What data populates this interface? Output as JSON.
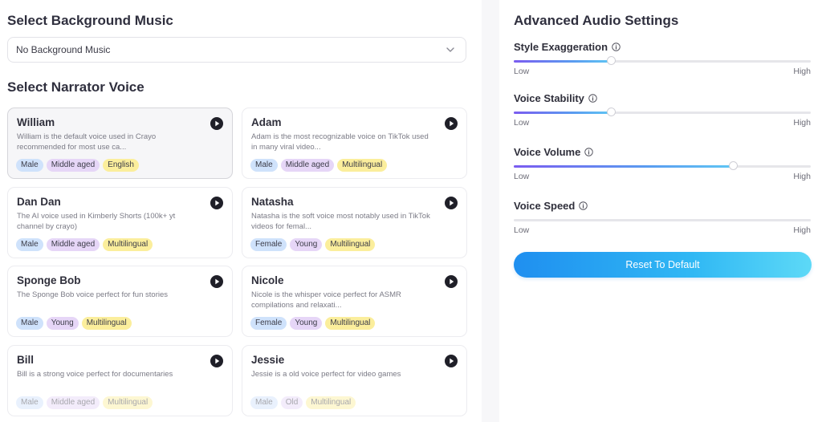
{
  "music": {
    "title": "Select Background Music",
    "selected": "No Background Music"
  },
  "narrator": {
    "title": "Select Narrator Voice",
    "voices": [
      {
        "name": "William",
        "desc": "William is the default voice used in Crayo recommended for most use ca...",
        "tags": [
          {
            "label": "Male",
            "color": "blue"
          },
          {
            "label": "Middle aged",
            "color": "purple"
          },
          {
            "label": "English",
            "color": "yellow"
          }
        ]
      },
      {
        "name": "Adam",
        "desc": "Adam is the most recognizable voice on TikTok used in many viral video...",
        "tags": [
          {
            "label": "Male",
            "color": "blue"
          },
          {
            "label": "Middle aged",
            "color": "purple"
          },
          {
            "label": "Multilingual",
            "color": "yellow"
          }
        ]
      },
      {
        "name": "Dan Dan",
        "desc": "The AI voice used in Kimberly Shorts (100k+ yt channel by crayo)",
        "tags": [
          {
            "label": "Male",
            "color": "blue"
          },
          {
            "label": "Middle aged",
            "color": "purple"
          },
          {
            "label": "Multilingual",
            "color": "yellow"
          }
        ]
      },
      {
        "name": "Natasha",
        "desc": "Natasha is the soft voice most notably used in TikTok videos for femal...",
        "tags": [
          {
            "label": "Female",
            "color": "blue"
          },
          {
            "label": "Young",
            "color": "purple"
          },
          {
            "label": "Multilingual",
            "color": "yellow"
          }
        ]
      },
      {
        "name": "Sponge Bob",
        "desc": "The Sponge Bob voice perfect for fun stories",
        "tags": [
          {
            "label": "Male",
            "color": "blue"
          },
          {
            "label": "Young",
            "color": "purple"
          },
          {
            "label": "Multilingual",
            "color": "yellow"
          }
        ]
      },
      {
        "name": "Nicole",
        "desc": "Nicole is the whisper voice perfect for ASMR compilations and relaxati...",
        "tags": [
          {
            "label": "Female",
            "color": "blue"
          },
          {
            "label": "Young",
            "color": "purple"
          },
          {
            "label": "Multilingual",
            "color": "yellow"
          }
        ]
      },
      {
        "name": "Bill",
        "desc": "Bill is a strong voice perfect for documentaries",
        "tags": [
          {
            "label": "Male",
            "color": "blue"
          },
          {
            "label": "Middle aged",
            "color": "purple"
          },
          {
            "label": "Multilingual",
            "color": "yellow"
          }
        ]
      },
      {
        "name": "Jessie",
        "desc": "Jessie is a old voice perfect for video games",
        "tags": [
          {
            "label": "Male",
            "color": "blue"
          },
          {
            "label": "Old",
            "color": "purple"
          },
          {
            "label": "Multilingual",
            "color": "yellow"
          }
        ]
      }
    ]
  },
  "audio": {
    "title": "Advanced Audio Settings",
    "low_label": "Low",
    "high_label": "High",
    "sliders": [
      {
        "label": "Style Exaggeration",
        "value": 0.33
      },
      {
        "label": "Voice Stability",
        "value": 0.33
      },
      {
        "label": "Voice Volume",
        "value": 0.74
      },
      {
        "label": "Voice Speed",
        "value": 0.0
      }
    ],
    "reset_label": "Reset To Default"
  }
}
